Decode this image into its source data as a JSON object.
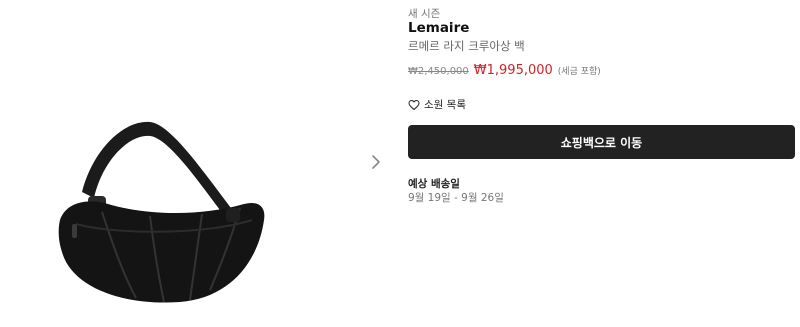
{
  "product": {
    "badge": "새 시즌",
    "brand": "Lemaire",
    "name": "르메르 라지 크루아상 백",
    "image_icon": "crossbody-bag-image",
    "price": {
      "original": "₩2,450,000",
      "sale": "₩1,995,000",
      "tax_note": "(세금 포함)",
      "sale_color": "#d2232a"
    }
  },
  "gallery": {
    "next_icon": "chevron-right-icon"
  },
  "wishlist": {
    "icon": "heart-outline-icon",
    "label": "소원 목록"
  },
  "cart": {
    "label": "쇼핑백으로 이동",
    "color": "#222222"
  },
  "delivery": {
    "title": "예상 배송일",
    "dates": "9월 19일 - 9월 26일"
  }
}
